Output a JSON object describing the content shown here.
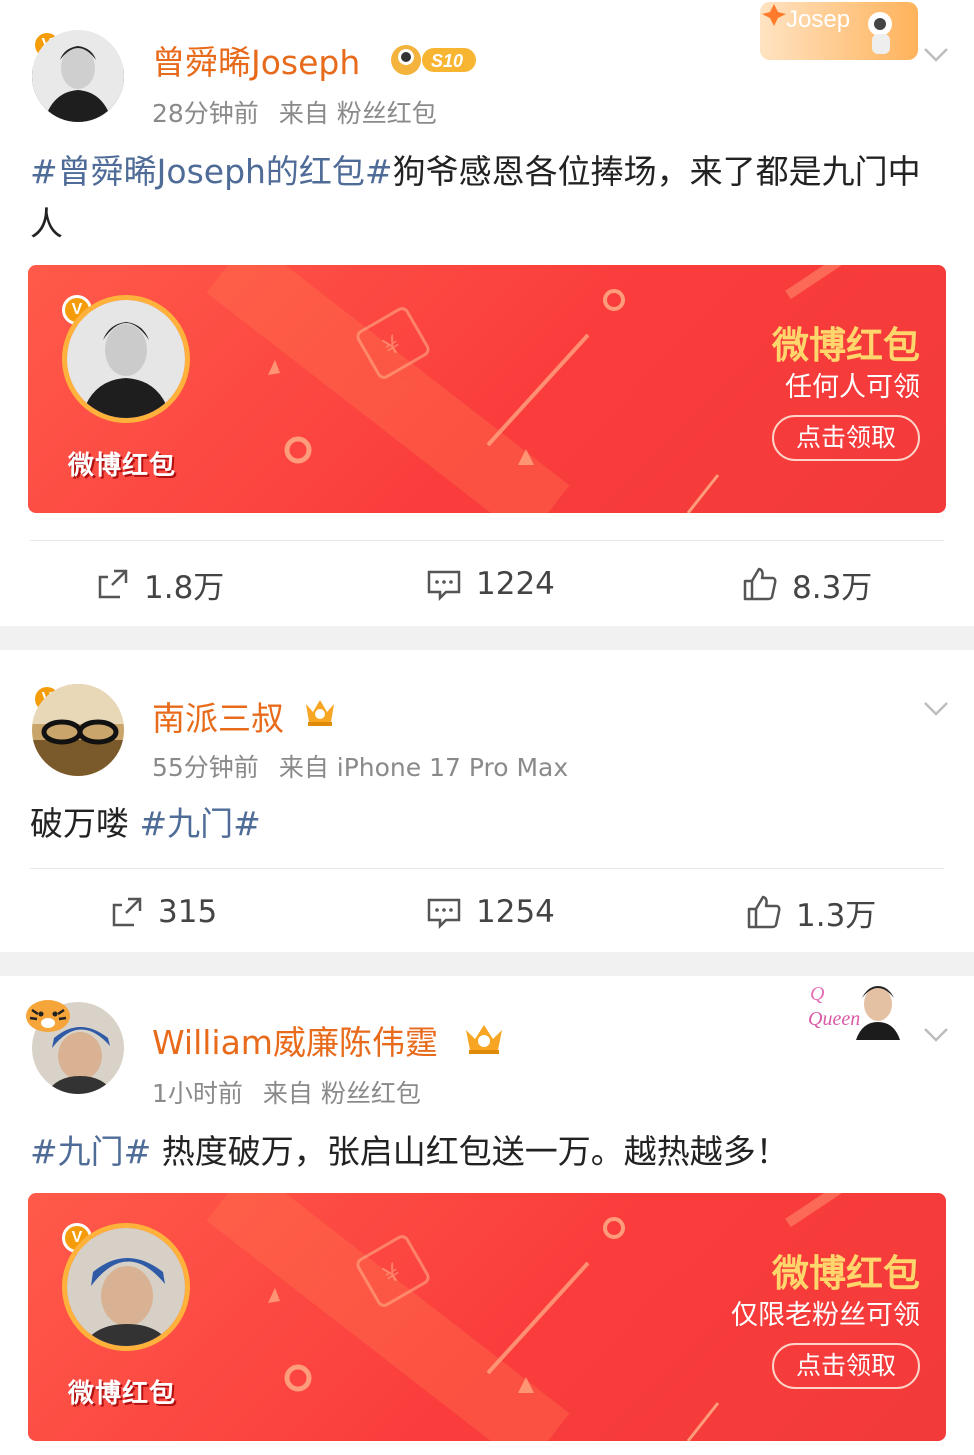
{
  "colors": {
    "name": "#e86b1c",
    "topic": "#4f6b97",
    "meta": "#8a8a8a",
    "redpacket": "#fa3c3c",
    "gold": "#ffd66b"
  },
  "posts": [
    {
      "author": "曾舜晞Joseph",
      "level_badge": "S10",
      "time": "28分钟前",
      "source": "来自 粉丝红包",
      "topic": "#曾舜晞Joseph的红包#",
      "text": "狗爷感恩各位捧场，来了都是九门中人",
      "redpacket": {
        "logo": "微博红包",
        "title": "微博红包",
        "subtitle": "任何人可领",
        "button": "点击领取"
      },
      "card_deco_text": "Josep",
      "repost": "1.8万",
      "comment": "1224",
      "like": "8.3万"
    },
    {
      "author": "南派三叔",
      "time": "55分钟前",
      "source": "来自 iPhone 17 Pro Max",
      "text": "破万喽 ",
      "topic": "#九门#",
      "repost": "315",
      "comment": "1254",
      "like": "1.3万"
    },
    {
      "author": "William威廉陈伟霆",
      "time": "1小时前",
      "source": "来自 粉丝红包",
      "topic": "#九门#",
      "text": " 热度破万，张启山红包送一万。越热越多！",
      "redpacket": {
        "logo": "微博红包",
        "title": "微博红包",
        "subtitle": "仅限老粉丝可领",
        "button": "点击领取"
      },
      "card_deco_text": "Queen"
    }
  ],
  "icons": {
    "repost": "repost-icon",
    "comment": "comment-icon",
    "like": "like-icon",
    "more": "chevron-down-icon",
    "verified": "verified-icon"
  },
  "verified_mark": "V"
}
